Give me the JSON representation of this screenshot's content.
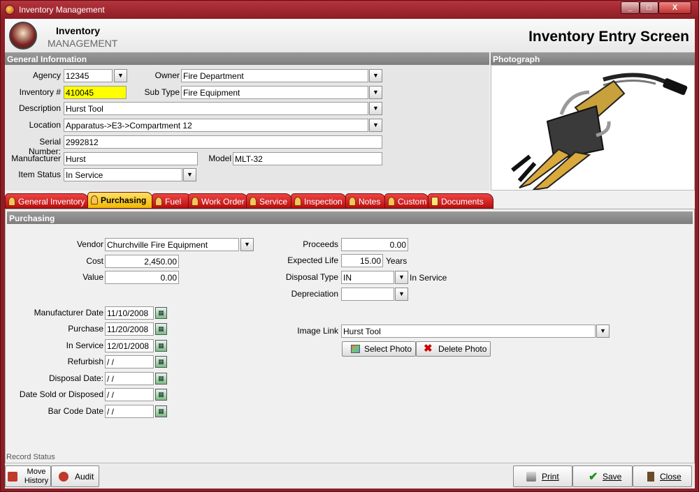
{
  "window": {
    "title": "Inventory Management",
    "min": "_",
    "max": "□",
    "close": "X"
  },
  "header": {
    "logo_line1": "Inventory",
    "logo_line2": "MANAGEMENT",
    "screen_title": "Inventory Entry Screen"
  },
  "general": {
    "title": "General Information",
    "agency_label": "Agency",
    "agency": "12345",
    "owner_label": "Owner",
    "owner": "Fire Department",
    "inventory_label": "Inventory #",
    "inventory": "410045",
    "subtype_label": "Sub Type",
    "subtype": "Fire Equipment",
    "description_label": "Description",
    "description": "Hurst Tool",
    "location_label": "Location",
    "location": "Apparatus->E3->Compartment 12",
    "serial_label": "Serial Number:",
    "serial": "2992812",
    "manufacturer_label": "Manufacturer",
    "manufacturer": "Hurst",
    "model_label": "Model",
    "model": "MLT-32",
    "status_label": "Item Status",
    "status": "In Service"
  },
  "photo": {
    "title": "Photograph"
  },
  "tabs": [
    {
      "label": "General Inventory"
    },
    {
      "label": "Purchasing"
    },
    {
      "label": "Fuel"
    },
    {
      "label": "Work Order"
    },
    {
      "label": "Service"
    },
    {
      "label": "Inspection"
    },
    {
      "label": "Notes"
    },
    {
      "label": "Custom"
    },
    {
      "label": "Documents"
    }
  ],
  "purchasing": {
    "title": "Purchasing",
    "vendor_label": "Vendor",
    "vendor": "Churchville Fire Equipment",
    "cost_label": "Cost",
    "cost": "2,450.00",
    "value_label": "Value",
    "value": "0.00",
    "proceeds_label": "Proceeds",
    "proceeds": "0.00",
    "life_label": "Expected Life",
    "life": "15.00",
    "life_unit": "Years",
    "disposal_type_label": "Disposal Type",
    "disposal_type": "IN",
    "disposal_type_desc": "In Service",
    "depreciation_label": "Depreciation",
    "depreciation": "",
    "mfg_date_label": "Manufacturer Date",
    "mfg_date": "11/10/2008",
    "purchase_label": "Purchase",
    "purchase": "11/20/2008",
    "inservice_label": "In Service",
    "inservice": "12/01/2008",
    "refurbish_label": "Refurbish",
    "refurbish": " / /",
    "disposal_date_label": "Disposal Date:",
    "disposal_date": " / /",
    "sold_label": "Date Sold or Disposed",
    "sold": " / /",
    "barcode_label": "Bar Code Date",
    "barcode": " / /",
    "image_link_label": "Image Link",
    "image_link": "Hurst Tool",
    "select_photo": "Select Photo",
    "delete_photo": "Delete Photo"
  },
  "record_status": "Record Status",
  "footer": {
    "move_line1": "Move",
    "move_line2": "History",
    "audit": "Audit",
    "print": "Print",
    "save": "Save",
    "close": "Close"
  }
}
